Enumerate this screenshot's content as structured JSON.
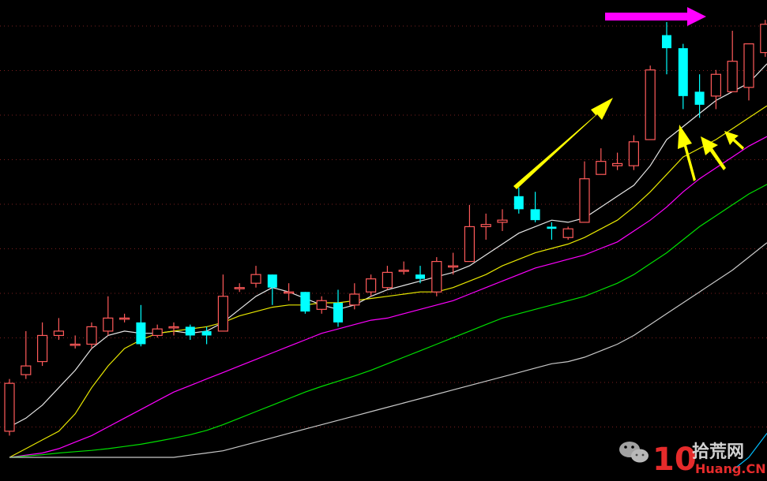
{
  "chart_data": {
    "type": "candlestick",
    "title": "",
    "xlabel": "",
    "ylabel": "",
    "grid": true,
    "ylim": [
      0,
      100
    ],
    "colors": {
      "background": "#000000",
      "grid": "#7a1f1f",
      "up": "#ff5a5a",
      "down": "#00ffff",
      "ma_white": "#e6e6e6",
      "ma_yellow": "#e8e800",
      "ma_magenta": "#ff00ff",
      "ma_green": "#00e000",
      "ma_gray": "#c8c8c8",
      "ma_cyan": "#00bfff",
      "arrow_magenta": "#ff00ff",
      "arrow_yellow": "#ffff00"
    },
    "candles": [
      {
        "o": 6,
        "c": 17,
        "h": 18,
        "l": 5
      },
      {
        "o": 19,
        "c": 21,
        "h": 29,
        "l": 18
      },
      {
        "o": 22,
        "c": 28,
        "h": 31,
        "l": 21
      },
      {
        "o": 28,
        "c": 29,
        "h": 32,
        "l": 27
      },
      {
        "o": 26,
        "c": 26,
        "h": 28,
        "l": 25
      },
      {
        "o": 26,
        "c": 30,
        "h": 31,
        "l": 25
      },
      {
        "o": 29,
        "c": 32,
        "h": 37,
        "l": 28
      },
      {
        "o": 32,
        "c": 32,
        "h": 33,
        "l": 31
      },
      {
        "o": 31,
        "c": 26,
        "h": 35,
        "l": 25.5
      },
      {
        "o": 28,
        "c": 29.5,
        "h": 30.5,
        "l": 27.5
      },
      {
        "o": 30,
        "c": 30,
        "h": 31,
        "l": 28
      },
      {
        "o": 30,
        "c": 28,
        "h": 30.5,
        "l": 27
      },
      {
        "o": 29,
        "c": 28,
        "h": 30,
        "l": 26
      },
      {
        "o": 29,
        "c": 37,
        "h": 42,
        "l": 29
      },
      {
        "o": 39,
        "c": 39,
        "h": 40,
        "l": 38
      },
      {
        "o": 40,
        "c": 42,
        "h": 44,
        "l": 39
      },
      {
        "o": 42,
        "c": 39,
        "h": 42,
        "l": 35
      },
      {
        "o": 38,
        "c": 38,
        "h": 40,
        "l": 36
      },
      {
        "o": 38,
        "c": 33.5,
        "h": 38,
        "l": 33
      },
      {
        "o": 34,
        "c": 36,
        "h": 37,
        "l": 33
      },
      {
        "o": 35.5,
        "c": 31,
        "h": 38.5,
        "l": 30
      },
      {
        "o": 35,
        "c": 37.5,
        "h": 40,
        "l": 34
      },
      {
        "o": 38,
        "c": 41,
        "h": 42,
        "l": 37
      },
      {
        "o": 39,
        "c": 42.5,
        "h": 44,
        "l": 38.5
      },
      {
        "o": 43,
        "c": 43,
        "h": 45,
        "l": 42
      },
      {
        "o": 42,
        "c": 41,
        "h": 44,
        "l": 40
      },
      {
        "o": 38,
        "c": 45,
        "h": 46,
        "l": 37
      },
      {
        "o": 44,
        "c": 44,
        "h": 47,
        "l": 42
      },
      {
        "o": 45,
        "c": 53,
        "h": 58,
        "l": 45
      },
      {
        "o": 53,
        "c": 53.5,
        "h": 56,
        "l": 50
      },
      {
        "o": 54,
        "c": 54.5,
        "h": 57,
        "l": 52
      },
      {
        "o": 60,
        "c": 57,
        "h": 62,
        "l": 56
      },
      {
        "o": 57,
        "c": 54.5,
        "h": 61,
        "l": 54
      },
      {
        "o": 53,
        "c": 52.5,
        "h": 54,
        "l": 50
      },
      {
        "o": 50.5,
        "c": 52.5,
        "h": 53,
        "l": 50
      },
      {
        "o": 54,
        "c": 64,
        "h": 68,
        "l": 54
      },
      {
        "o": 65,
        "c": 68,
        "h": 71,
        "l": 65
      },
      {
        "o": 67,
        "c": 67.5,
        "h": 70,
        "l": 66
      },
      {
        "o": 67,
        "c": 72.5,
        "h": 74,
        "l": 66
      },
      {
        "o": 73,
        "c": 89,
        "h": 90,
        "l": 73
      },
      {
        "o": 97,
        "c": 94,
        "h": 100,
        "l": 88
      },
      {
        "o": 94,
        "c": 83,
        "h": 95,
        "l": 80
      },
      {
        "o": 84,
        "c": 81,
        "h": 88,
        "l": 78
      },
      {
        "o": 83,
        "c": 88,
        "h": 89,
        "l": 80
      },
      {
        "o": 84,
        "c": 91,
        "h": 98,
        "l": 84
      },
      {
        "o": 85,
        "c": 95,
        "h": 95,
        "l": 82
      },
      {
        "o": 93,
        "c": 99.5,
        "h": 100.5,
        "l": 92
      }
    ],
    "moving_averages": [
      {
        "color_key": "ma_white",
        "y": [
          7,
          9,
          12,
          16,
          20,
          25,
          28,
          29,
          28.5,
          28.5,
          29,
          28.5,
          29,
          31,
          34,
          37,
          39,
          38,
          36.5,
          35,
          34,
          35,
          37,
          38.5,
          39.5,
          40.5,
          41.5,
          42.5,
          44,
          46.5,
          49,
          51.5,
          53,
          54.5,
          54,
          55,
          57.5,
          60,
          62.5,
          67,
          73,
          76,
          79,
          82,
          84,
          86,
          90
        ]
      },
      {
        "color_key": "ma_yellow",
        "y": [
          0,
          2,
          4,
          6,
          10,
          16,
          21,
          25,
          27,
          28.5,
          29,
          29.5,
          30,
          31,
          32.5,
          33.5,
          34.5,
          35,
          35,
          35.5,
          35.5,
          36,
          36.5,
          37,
          37.5,
          38,
          38,
          39,
          40.5,
          42,
          44,
          45.5,
          47,
          48,
          49,
          50.5,
          52.5,
          54.5,
          57.5,
          61,
          65,
          69,
          71,
          73,
          75.5,
          78,
          80.5
        ]
      },
      {
        "color_key": "ma_magenta",
        "y": [
          0,
          0.5,
          1,
          2,
          3.5,
          5,
          7,
          9,
          11,
          13,
          15,
          16.5,
          18,
          19.5,
          21,
          22.5,
          24,
          25.5,
          27,
          28.5,
          29.5,
          30.5,
          31.5,
          32,
          33,
          34,
          35,
          36,
          37.5,
          39,
          40.5,
          42,
          43.5,
          44.5,
          45.5,
          46.5,
          48,
          49.5,
          52,
          54.5,
          57.5,
          61,
          64,
          66.5,
          69,
          71.5,
          73.5
        ]
      },
      {
        "color_key": "ma_green",
        "y": [
          0,
          0.3,
          0.6,
          1,
          1.3,
          1.6,
          2,
          2.5,
          3,
          3.7,
          4.4,
          5.2,
          6.2,
          7.5,
          9,
          10.5,
          12,
          13.5,
          15,
          16.3,
          17.5,
          18.7,
          20,
          21.5,
          23,
          24.5,
          26,
          27.5,
          29,
          30.5,
          32,
          33,
          34,
          35,
          36,
          37,
          38.5,
          40,
          42,
          44.5,
          47,
          50,
          53,
          55.5,
          58,
          60.5,
          62.5
        ]
      },
      {
        "color_key": "ma_gray",
        "y": [
          0,
          0,
          0,
          0,
          0,
          0,
          0,
          0,
          0,
          0,
          0,
          0.5,
          1,
          1.5,
          2.5,
          3.5,
          4.5,
          5.5,
          6.5,
          7.5,
          8.5,
          9.5,
          10.5,
          11.5,
          12.5,
          13.5,
          14.5,
          15.5,
          16.5,
          17.5,
          18.5,
          19.5,
          20.5,
          21.5,
          22,
          23,
          24.5,
          26,
          28,
          30.5,
          33,
          35.5,
          38,
          40.5,
          43,
          46,
          49
        ]
      },
      {
        "color_key": "ma_cyan",
        "y": [
          null,
          null,
          null,
          null,
          null,
          null,
          null,
          null,
          null,
          null,
          null,
          null,
          null,
          null,
          null,
          null,
          null,
          null,
          null,
          null,
          null,
          null,
          null,
          null,
          null,
          null,
          null,
          null,
          null,
          null,
          null,
          null,
          null,
          null,
          null,
          null,
          null,
          null,
          null,
          null,
          null,
          null,
          null,
          null,
          -3,
          0,
          5
        ]
      }
    ]
  },
  "watermark": {
    "logo_text": "10",
    "brand_text": "拾荒网",
    "domain_text": "Huang.CN",
    "wechat_icon": "wechat-icon"
  }
}
